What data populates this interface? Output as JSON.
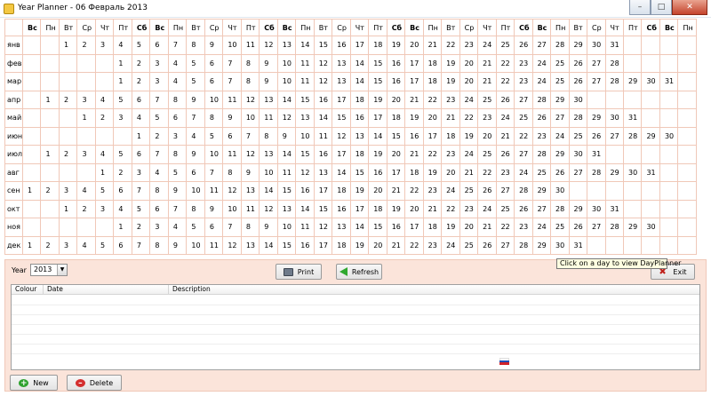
{
  "window": {
    "title": "Year Planner - 06 Февраль 2013"
  },
  "calendar": {
    "day_headers": [
      "Вс",
      "Пн",
      "Вт",
      "Ср",
      "Чт",
      "Пт",
      "Сб",
      "Вс",
      "Пн",
      "Вт",
      "Ср",
      "Чт",
      "Пт",
      "Сб",
      "Вс",
      "Пн",
      "Вт",
      "Ср",
      "Чт",
      "Пт",
      "Сб",
      "Вс",
      "Пн",
      "Вт",
      "Ср",
      "Чт",
      "Пт",
      "Сб",
      "Вс",
      "Пн",
      "Вт",
      "Ср",
      "Чт",
      "Пт",
      "Сб",
      "Вс",
      "Пн"
    ],
    "months": [
      {
        "name": "янв",
        "offset": 2,
        "days": 31
      },
      {
        "name": "фев",
        "offset": 5,
        "days": 28
      },
      {
        "name": "мар",
        "offset": 5,
        "days": 31
      },
      {
        "name": "апр",
        "offset": 1,
        "days": 30
      },
      {
        "name": "май",
        "offset": 3,
        "days": 31
      },
      {
        "name": "июн",
        "offset": 6,
        "days": 30
      },
      {
        "name": "июл",
        "offset": 1,
        "days": 31
      },
      {
        "name": "авг",
        "offset": 4,
        "days": 31
      },
      {
        "name": "сен",
        "offset": 0,
        "days": 30
      },
      {
        "name": "окт",
        "offset": 2,
        "days": 31
      },
      {
        "name": "ноя",
        "offset": 5,
        "days": 30
      },
      {
        "name": "дек",
        "offset": 0,
        "days": 31
      }
    ]
  },
  "toolbar": {
    "year_label": "Year",
    "year_value": "2013",
    "print_label": "Print",
    "refresh_label": "Refresh",
    "exit_label": "Exit"
  },
  "tooltip": "Click on a day to view DayPlanner",
  "list": {
    "columns": [
      "Colour",
      "Date",
      "Description"
    ]
  },
  "footer": {
    "new_label": "New",
    "delete_label": "Delete"
  }
}
